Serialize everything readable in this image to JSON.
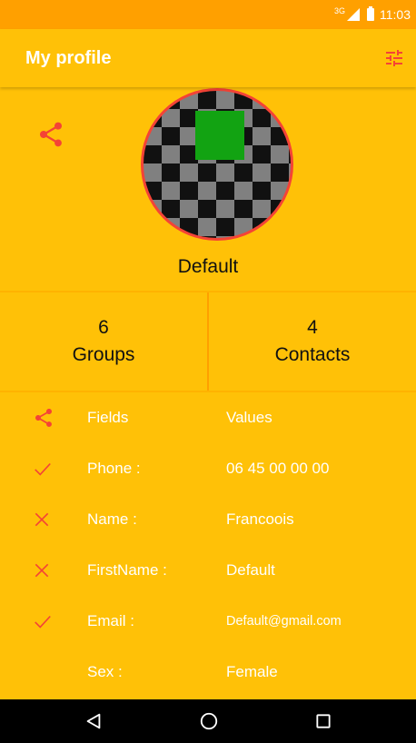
{
  "status_bar": {
    "network": "3G",
    "time": "11:03"
  },
  "app_bar": {
    "title": "My profile",
    "action_icon": "tune-icon"
  },
  "profile": {
    "name": "Default",
    "share_icon": "share-icon"
  },
  "stats": [
    {
      "count": "6",
      "label": "Groups"
    },
    {
      "count": "4",
      "label": "Contacts"
    }
  ],
  "fields": {
    "header": {
      "field": "Fields",
      "value": "Values"
    },
    "rows": [
      {
        "field": "Phone :",
        "value": "06 45 00 00 00",
        "status": "check"
      },
      {
        "field": "Name :",
        "value": "Francoois",
        "status": "close"
      },
      {
        "field": "FirstName :",
        "value": "Default",
        "status": "close"
      },
      {
        "field": "Email :",
        "value": "Default@gmail.com",
        "status": "check"
      },
      {
        "field": "Sex :",
        "value": "Female",
        "status": "none"
      }
    ]
  },
  "nav_bar": {
    "back": "back-icon",
    "home": "home-icon",
    "recents": "recents-icon"
  },
  "colors": {
    "primary": "#FFC107",
    "status_bar": "#FFA000",
    "accent": "#F44336",
    "avatar_square": "#12A312"
  }
}
